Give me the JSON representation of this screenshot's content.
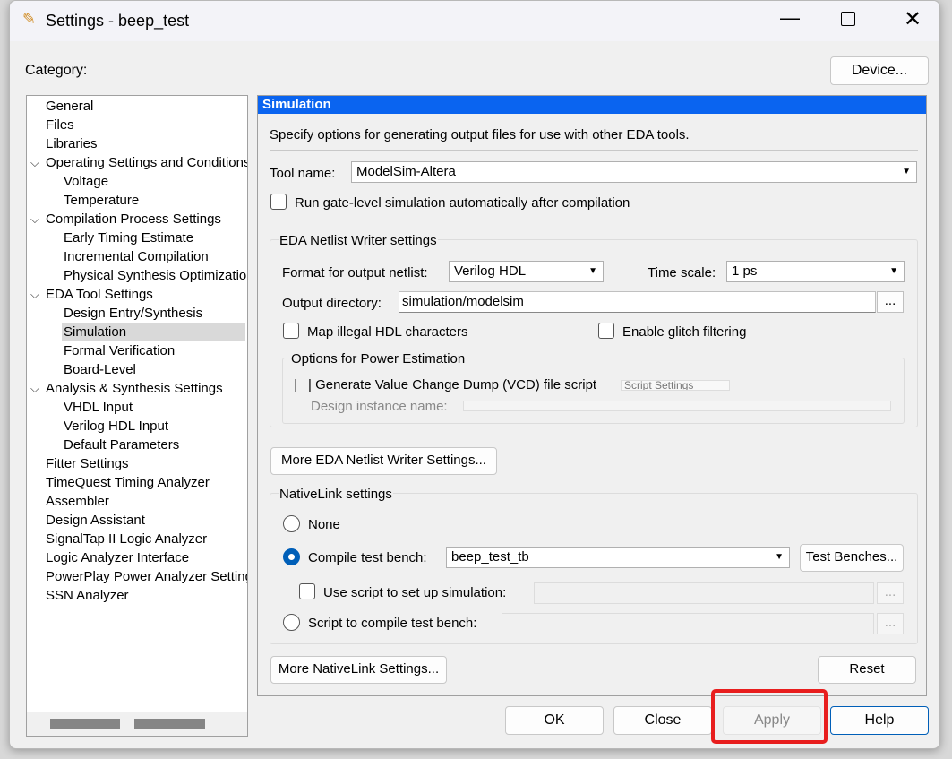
{
  "window": {
    "title": "Settings - beep_test",
    "icon": "pencil-settings-icon"
  },
  "category_label": "Category:",
  "device_button": "Device...",
  "tree": [
    {
      "label": "General",
      "level": 0
    },
    {
      "label": "Files",
      "level": 0
    },
    {
      "label": "Libraries",
      "level": 0
    },
    {
      "label": "Operating Settings and Conditions",
      "level": 0,
      "expanded": true
    },
    {
      "label": "Voltage",
      "level": 1
    },
    {
      "label": "Temperature",
      "level": 1
    },
    {
      "label": "Compilation Process Settings",
      "level": 0,
      "expanded": true
    },
    {
      "label": "Early Timing Estimate",
      "level": 1
    },
    {
      "label": "Incremental Compilation",
      "level": 1
    },
    {
      "label": "Physical Synthesis Optimizations",
      "level": 1
    },
    {
      "label": "EDA Tool Settings",
      "level": 0,
      "expanded": true
    },
    {
      "label": "Design Entry/Synthesis",
      "level": 1
    },
    {
      "label": "Simulation",
      "level": 1,
      "selected": true
    },
    {
      "label": "Formal Verification",
      "level": 1
    },
    {
      "label": "Board-Level",
      "level": 1
    },
    {
      "label": "Analysis & Synthesis Settings",
      "level": 0,
      "expanded": true
    },
    {
      "label": "VHDL Input",
      "level": 1
    },
    {
      "label": "Verilog HDL Input",
      "level": 1
    },
    {
      "label": "Default Parameters",
      "level": 1
    },
    {
      "label": "Fitter Settings",
      "level": 0
    },
    {
      "label": "TimeQuest Timing Analyzer",
      "level": 0
    },
    {
      "label": "Assembler",
      "level": 0
    },
    {
      "label": "Design Assistant",
      "level": 0
    },
    {
      "label": "SignalTap II Logic Analyzer",
      "level": 0
    },
    {
      "label": "Logic Analyzer Interface",
      "level": 0
    },
    {
      "label": "PowerPlay Power Analyzer Settings",
      "level": 0
    },
    {
      "label": "SSN Analyzer",
      "level": 0
    }
  ],
  "panel": {
    "title": "Simulation",
    "description": "Specify options for generating output files for use with other EDA tools.",
    "tool_name_label": "Tool name:",
    "tool_name_value": "ModelSim-Altera",
    "run_gate_level": "Run gate-level simulation automatically after compilation",
    "eda": {
      "title": "EDA Netlist Writer settings",
      "format_label": "Format for output netlist:",
      "format_value": "Verilog HDL",
      "time_scale_label": "Time scale:",
      "time_scale_value": "1 ps",
      "output_dir_label": "Output directory:",
      "output_dir_value": "simulation/modelsim",
      "browse": "...",
      "map_illegal": "Map illegal HDL characters",
      "glitch": "Enable glitch filtering",
      "power": {
        "title": "Options for Power Estimation",
        "vcd": "Generate Value Change Dump (VCD) file script",
        "script_settings": "Script Settings",
        "instance_label": "Design instance name:"
      }
    },
    "more_eda": "More EDA Netlist Writer Settings...",
    "nativelink": {
      "title": "NativeLink settings",
      "none": "None",
      "compile_tb_label": "Compile test bench:",
      "compile_tb_value": "beep_test_tb",
      "test_benches": "Test Benches...",
      "use_script": "Use script to set up simulation:",
      "script_compile": "Script to compile test bench:",
      "browse": "..."
    },
    "more_nativelink": "More NativeLink Settings...",
    "reset": "Reset"
  },
  "footer": {
    "ok": "OK",
    "close": "Close",
    "apply": "Apply",
    "help": "Help"
  },
  "colors": {
    "header": "#0a64f0",
    "highlight": "#e81e1e",
    "selected_item": "#d9d9d9"
  }
}
